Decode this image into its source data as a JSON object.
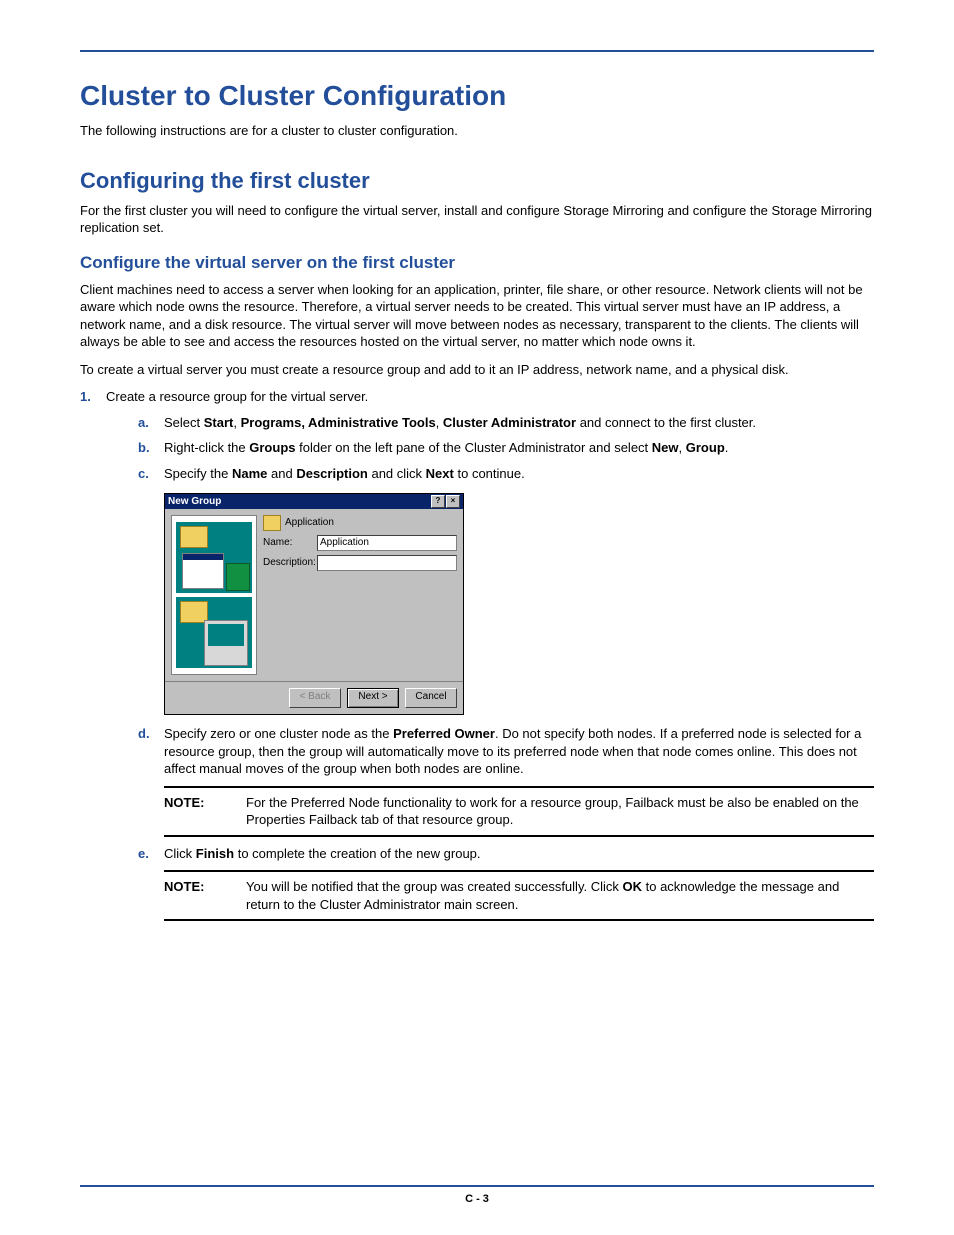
{
  "h1": "Cluster to Cluster Configuration",
  "intro": "The following instructions are for a cluster to cluster configuration.",
  "h2": "Configuring the first cluster",
  "h2_text": "For the first cluster you will need to configure the virtual server, install and configure Storage Mirroring and configure the Storage Mirroring replication set.",
  "h3": "Configure the virtual server on the first cluster",
  "h3_text1": "Client machines need to access a server when looking for an application, printer, file share, or other resource. Network clients will not be aware which node owns the resource. Therefore, a virtual server needs to be created. This virtual server must have an IP address, a network name, and a disk resource. The virtual server will move between nodes as necessary, transparent to the clients. The clients will always be able to see and access the resources hosted on the virtual server, no matter which node owns it.",
  "h3_text2": "To create a virtual server you must create a resource group and add to it an IP address, network name, and a physical disk.",
  "step1": {
    "num": "1.",
    "text": "Create a resource group for the virtual server.",
    "a": {
      "m": "a.",
      "t0": "Select",
      "b1": "Start",
      "b2": "Programs, Administrative Tools",
      "b3": "Cluster Administrator",
      "t1": "and connect to the first cluster."
    },
    "b": {
      "m": "b.",
      "t0": "Right-click the",
      "b1": "Groups",
      "t1": "folder on the left pane of the Cluster Administrator and select",
      "b2": "New",
      "b3": "Group"
    },
    "c": {
      "m": "c.",
      "t0": "Specify the",
      "b1": "Name",
      "t1": "and",
      "b2": "Description",
      "t2": "and click",
      "b3": "Next",
      "t3": "to continue."
    },
    "d": {
      "m": "d.",
      "t0": "Specify zero or one cluster node as the",
      "b1": "Preferred Owner",
      "t1": ". Do not specify both nodes. If a preferred node is selected for a resource group, then the group will automatically move to its preferred node when that node comes online. This does not affect manual moves of the group when both nodes are online."
    },
    "e": {
      "m": "e.",
      "t0": "Click",
      "b1": "Finish",
      "t1": "to complete the creation of the new group."
    }
  },
  "dialog": {
    "title": "New Group",
    "heading": "Application",
    "name_label": "Name:",
    "name_value": "Application",
    "desc_label": "Description:",
    "back": "< Back",
    "next": "Next >",
    "cancel": "Cancel"
  },
  "note1": {
    "label": "NOTE:",
    "text": "For the Preferred Node functionality to work for a resource group, Failback must be also be enabled on the Properties Failback tab of that resource group."
  },
  "note2": {
    "label": "NOTE:",
    "t0": "You will be notified that the group was created successfully. Click",
    "b1": "OK",
    "t1": "to acknowledge the message and return to the Cluster Administrator main screen."
  },
  "footer": "C - 3"
}
